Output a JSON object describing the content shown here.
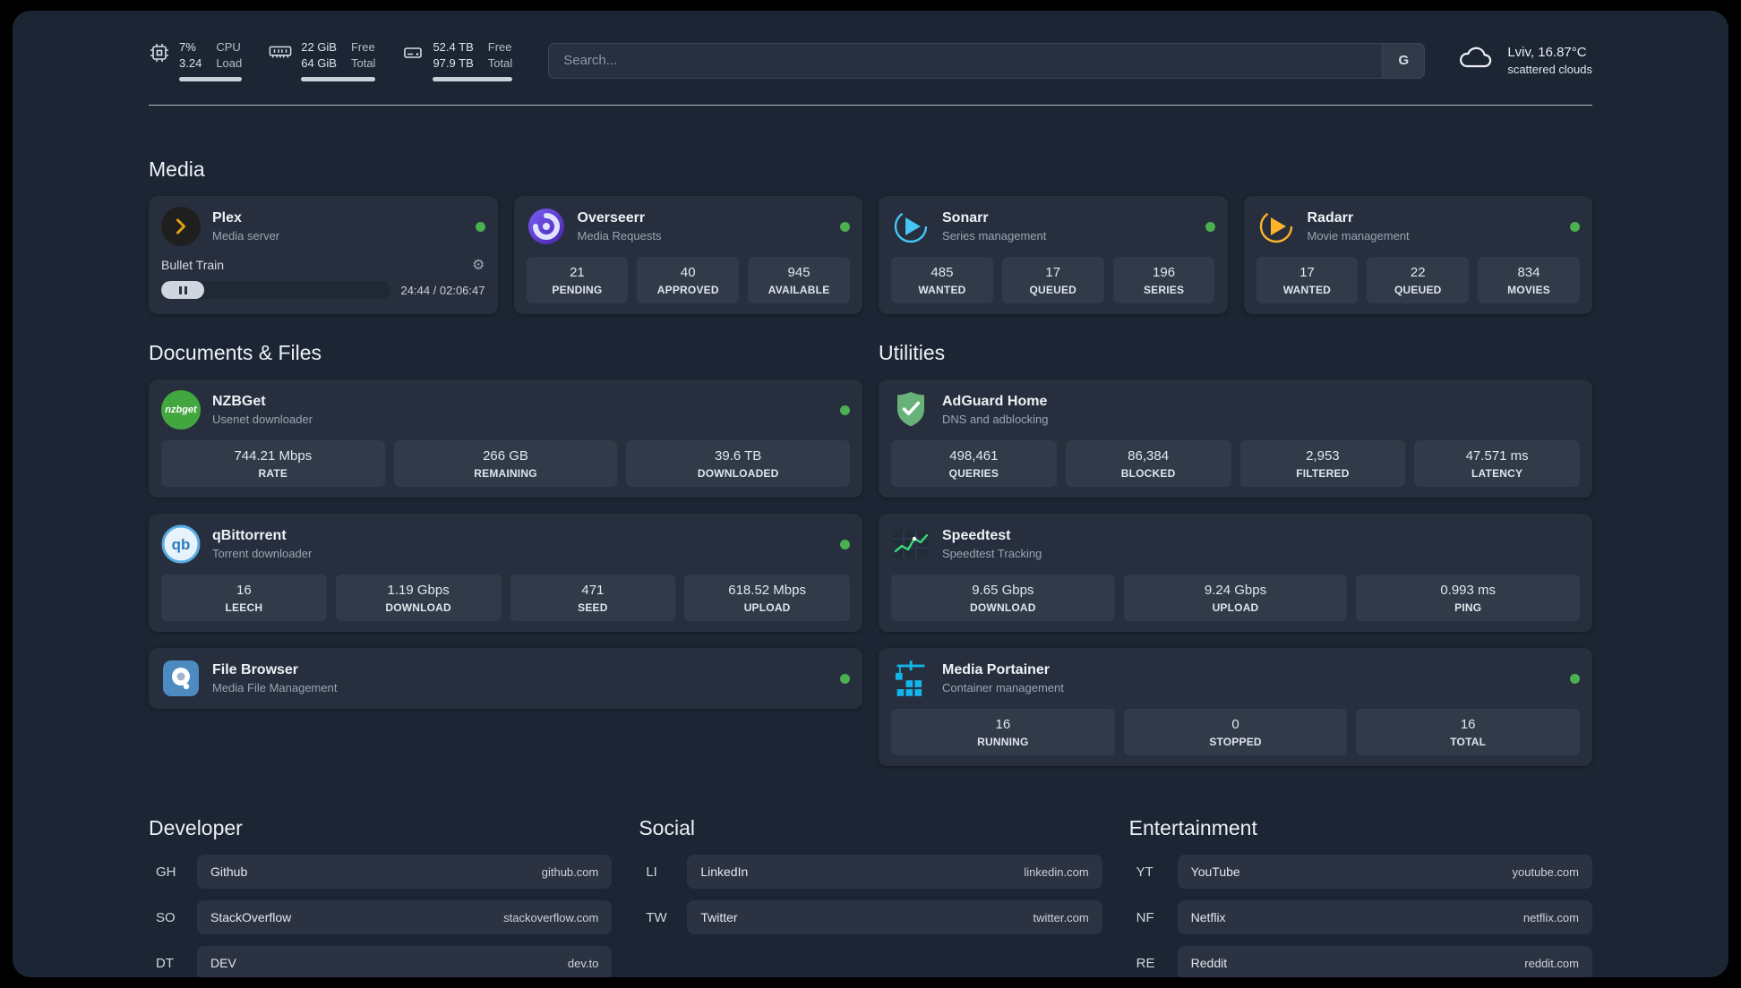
{
  "topbar": {
    "cpu": {
      "percent": "7%",
      "load": "3.24",
      "labels": [
        "CPU",
        "Load"
      ]
    },
    "ram": {
      "free": "22 GiB",
      "total": "64 GiB",
      "labels": [
        "Free",
        "Total"
      ]
    },
    "disk": {
      "free": "52.4 TB",
      "total": "97.9 TB",
      "labels": [
        "Free",
        "Total"
      ]
    },
    "search": {
      "placeholder": "Search...",
      "engine": "G"
    },
    "weather": {
      "location": "Lviv, 16.87°C",
      "condition": "scattered clouds"
    }
  },
  "media": {
    "title": "Media",
    "plex": {
      "name": "Plex",
      "desc": "Media server",
      "now_playing": "Bullet Train",
      "time": "24:44 / 02:06:47"
    },
    "overseerr": {
      "name": "Overseerr",
      "desc": "Media Requests",
      "stats": [
        {
          "v": "21",
          "l": "PENDING"
        },
        {
          "v": "40",
          "l": "APPROVED"
        },
        {
          "v": "945",
          "l": "AVAILABLE"
        }
      ]
    },
    "sonarr": {
      "name": "Sonarr",
      "desc": "Series management",
      "stats": [
        {
          "v": "485",
          "l": "WANTED"
        },
        {
          "v": "17",
          "l": "QUEUED"
        },
        {
          "v": "196",
          "l": "SERIES"
        }
      ]
    },
    "radarr": {
      "name": "Radarr",
      "desc": "Movie management",
      "stats": [
        {
          "v": "17",
          "l": "WANTED"
        },
        {
          "v": "22",
          "l": "QUEUED"
        },
        {
          "v": "834",
          "l": "MOVIES"
        }
      ]
    }
  },
  "documents": {
    "title": "Documents & Files",
    "nzbget": {
      "name": "NZBGet",
      "desc": "Usenet downloader",
      "stats": [
        {
          "v": "744.21 Mbps",
          "l": "RATE"
        },
        {
          "v": "266 GB",
          "l": "REMAINING"
        },
        {
          "v": "39.6 TB",
          "l": "DOWNLOADED"
        }
      ]
    },
    "qbittorrent": {
      "name": "qBittorrent",
      "desc": "Torrent downloader",
      "stats": [
        {
          "v": "16",
          "l": "LEECH"
        },
        {
          "v": "1.19 Gbps",
          "l": "DOWNLOAD"
        },
        {
          "v": "471",
          "l": "SEED"
        },
        {
          "v": "618.52 Mbps",
          "l": "UPLOAD"
        }
      ]
    },
    "filebrowser": {
      "name": "File Browser",
      "desc": "Media File Management"
    }
  },
  "utilities": {
    "title": "Utilities",
    "adguard": {
      "name": "AdGuard Home",
      "desc": "DNS and adblocking",
      "stats": [
        {
          "v": "498,461",
          "l": "QUERIES"
        },
        {
          "v": "86,384",
          "l": "BLOCKED"
        },
        {
          "v": "2,953",
          "l": "FILTERED"
        },
        {
          "v": "47.571 ms",
          "l": "LATENCY"
        }
      ]
    },
    "speedtest": {
      "name": "Speedtest",
      "desc": "Speedtest Tracking",
      "stats": [
        {
          "v": "9.65 Gbps",
          "l": "DOWNLOAD"
        },
        {
          "v": "9.24 Gbps",
          "l": "UPLOAD"
        },
        {
          "v": "0.993 ms",
          "l": "PING"
        }
      ]
    },
    "portainer": {
      "name": "Media Portainer",
      "desc": "Container management",
      "stats": [
        {
          "v": "16",
          "l": "RUNNING"
        },
        {
          "v": "0",
          "l": "STOPPED"
        },
        {
          "v": "16",
          "l": "TOTAL"
        }
      ]
    }
  },
  "links": {
    "developer": {
      "title": "Developer",
      "items": [
        {
          "abbr": "GH",
          "name": "Github",
          "url": "github.com"
        },
        {
          "abbr": "SO",
          "name": "StackOverflow",
          "url": "stackoverflow.com"
        },
        {
          "abbr": "DT",
          "name": "DEV",
          "url": "dev.to"
        }
      ]
    },
    "social": {
      "title": "Social",
      "items": [
        {
          "abbr": "LI",
          "name": "LinkedIn",
          "url": "linkedin.com"
        },
        {
          "abbr": "TW",
          "name": "Twitter",
          "url": "twitter.com"
        }
      ]
    },
    "entertainment": {
      "title": "Entertainment",
      "items": [
        {
          "abbr": "YT",
          "name": "YouTube",
          "url": "youtube.com"
        },
        {
          "abbr": "NF",
          "name": "Netflix",
          "url": "netflix.com"
        },
        {
          "abbr": "RE",
          "name": "Reddit",
          "url": "reddit.com"
        }
      ]
    }
  }
}
